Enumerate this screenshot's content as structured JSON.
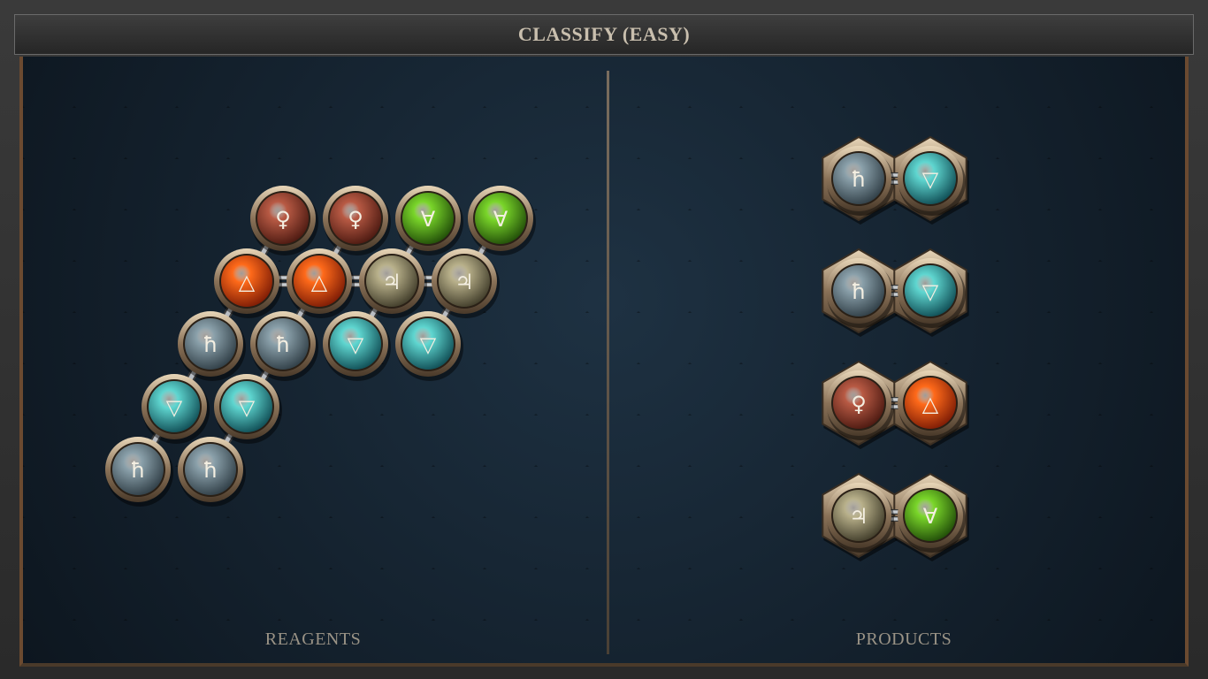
{
  "title": "CLASSIFY (EASY)",
  "panels": {
    "reagents_label": "REAGENTS",
    "products_label": "PRODUCTS"
  },
  "element_types": {
    "salt": {
      "icon": "salt-icon",
      "symbol": "ħ",
      "color": "#8aa0aa",
      "dark": "#2e3c44"
    },
    "water": {
      "icon": "water-icon",
      "symbol": "▽",
      "color": "#5fd6d0",
      "dark": "#0e4a52"
    },
    "fire": {
      "icon": "fire-icon",
      "symbol": "△",
      "color": "#ff6a1a",
      "dark": "#7a1a05"
    },
    "earth": {
      "icon": "earth-icon",
      "symbol": "∀",
      "color": "#7ad62a",
      "dark": "#1f4a08"
    },
    "copper": {
      "icon": "copper-icon",
      "symbol": "♀",
      "color": "#b85a44",
      "dark": "#4a1810"
    },
    "tin": {
      "icon": "tin-icon",
      "symbol": "♃",
      "color": "#b8b08a",
      "dark": "#3e3a28"
    }
  },
  "reagent_molecule": {
    "atoms": [
      {
        "id": "a1",
        "element": "copper",
        "row": 0,
        "col": 0
      },
      {
        "id": "a2",
        "element": "copper",
        "row": 0,
        "col": 1
      },
      {
        "id": "a3",
        "element": "earth",
        "row": 0,
        "col": 2
      },
      {
        "id": "a4",
        "element": "earth",
        "row": 0,
        "col": 3
      },
      {
        "id": "b1",
        "element": "fire",
        "row": 1,
        "col": 0
      },
      {
        "id": "b2",
        "element": "fire",
        "row": 1,
        "col": 1
      },
      {
        "id": "b3",
        "element": "tin",
        "row": 1,
        "col": 2
      },
      {
        "id": "b4",
        "element": "tin",
        "row": 1,
        "col": 3
      },
      {
        "id": "c1",
        "element": "salt",
        "row": 2,
        "col": 0
      },
      {
        "id": "c2",
        "element": "salt",
        "row": 2,
        "col": 1
      },
      {
        "id": "c3",
        "element": "water",
        "row": 2,
        "col": 2
      },
      {
        "id": "c4",
        "element": "water",
        "row": 2,
        "col": 3
      },
      {
        "id": "d1",
        "element": "water",
        "row": 3,
        "col": 0
      },
      {
        "id": "d2",
        "element": "water",
        "row": 3,
        "col": 1
      },
      {
        "id": "e1",
        "element": "salt",
        "row": 4,
        "col": 0
      },
      {
        "id": "e2",
        "element": "salt",
        "row": 4,
        "col": 1
      }
    ],
    "bonds": [
      [
        "a1",
        "b1",
        "single"
      ],
      [
        "a2",
        "b2",
        "single"
      ],
      [
        "a3",
        "b3",
        "single"
      ],
      [
        "a4",
        "b4",
        "single"
      ],
      [
        "b1",
        "b2",
        "double"
      ],
      [
        "b2",
        "b3",
        "double"
      ],
      [
        "b3",
        "b4",
        "double"
      ],
      [
        "b1",
        "c1",
        "single"
      ],
      [
        "b2",
        "c2",
        "single"
      ],
      [
        "b3",
        "c3",
        "single"
      ],
      [
        "b4",
        "c4",
        "single"
      ],
      [
        "c1",
        "d1",
        "single"
      ],
      [
        "c2",
        "d2",
        "single"
      ],
      [
        "d1",
        "e1",
        "single"
      ],
      [
        "d2",
        "e2",
        "single"
      ]
    ]
  },
  "products": [
    {
      "left": "salt",
      "right": "water",
      "bond": "double"
    },
    {
      "left": "salt",
      "right": "water",
      "bond": "double"
    },
    {
      "left": "copper",
      "right": "fire",
      "bond": "double"
    },
    {
      "left": "tin",
      "right": "earth",
      "bond": "double"
    }
  ]
}
